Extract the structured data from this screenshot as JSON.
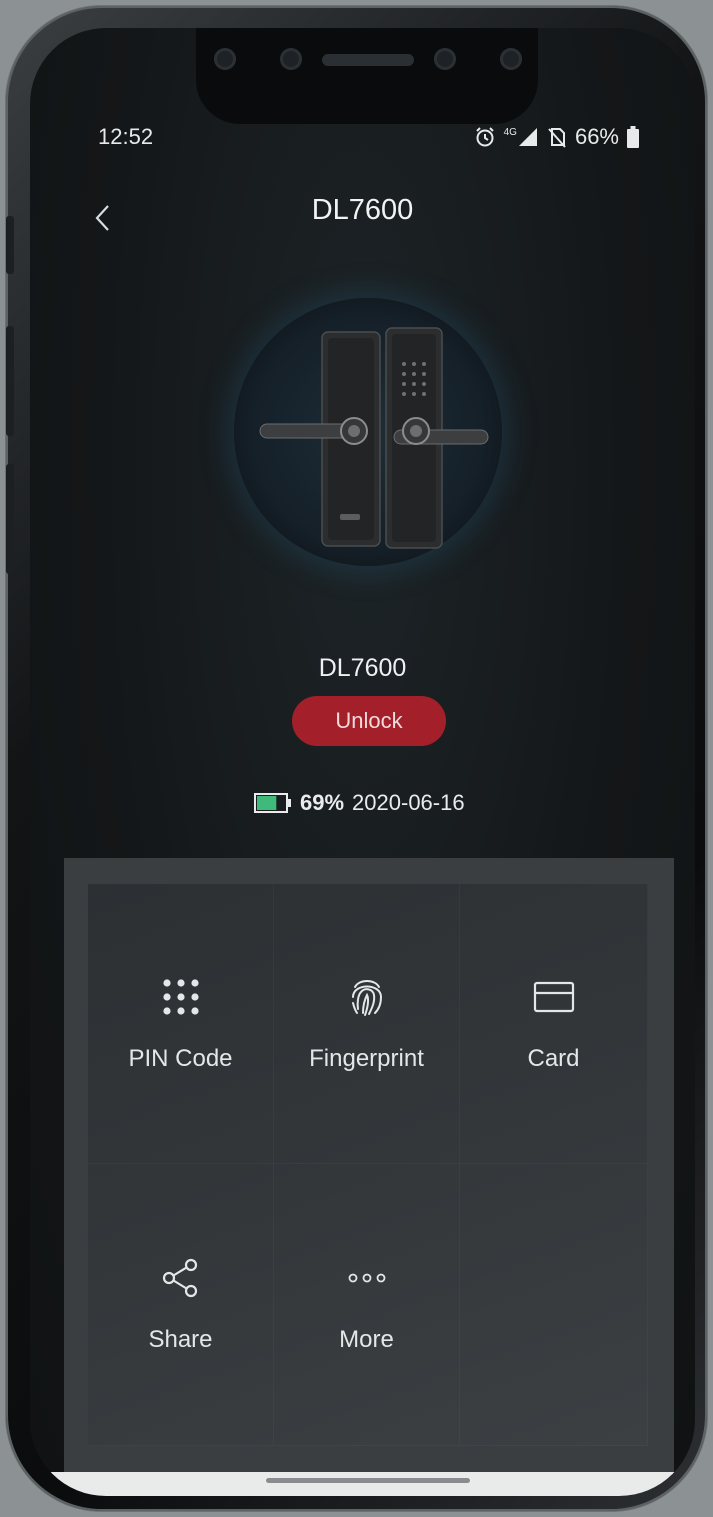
{
  "status_bar": {
    "time": "12:52",
    "network": "4G",
    "battery": "66%"
  },
  "header": {
    "title": "DL7600"
  },
  "device": {
    "name": "DL7600",
    "unlock_label": "Unlock",
    "battery_percent": "69%",
    "battery_level": 0.69,
    "date": "2020-06-16"
  },
  "menu": {
    "items": [
      {
        "label": "PIN Code",
        "icon": "keypad-icon"
      },
      {
        "label": "Fingerprint",
        "icon": "fingerprint-icon"
      },
      {
        "label": "Card",
        "icon": "card-icon"
      },
      {
        "label": "Share",
        "icon": "share-icon"
      },
      {
        "label": "More",
        "icon": "more-icon"
      }
    ]
  },
  "colors": {
    "accent_red": "#a3202a",
    "battery_green": "#3fba7a",
    "background": "#141719"
  }
}
